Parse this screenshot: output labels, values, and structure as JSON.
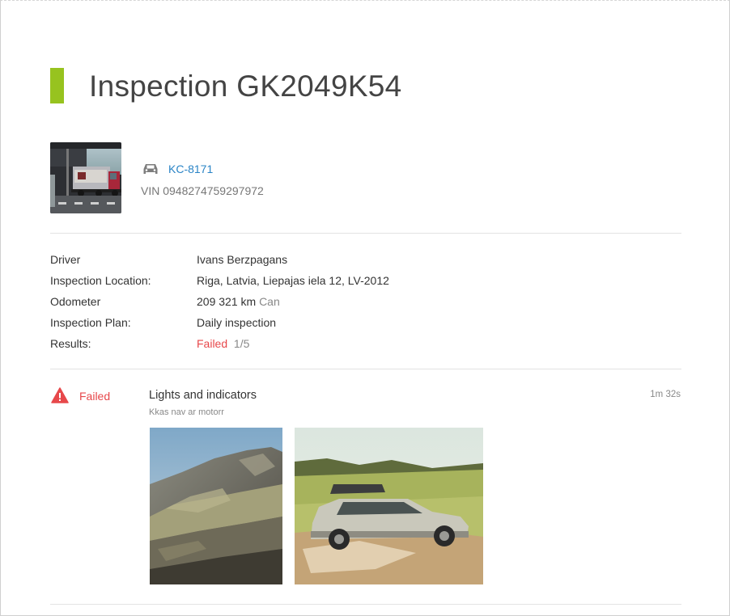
{
  "page": {
    "title": "Inspection GK2049K54",
    "accent_color": "#97c31f"
  },
  "vehicle": {
    "icon": "car-icon",
    "plate": "KC-8171",
    "vin": "VIN 0948274759297972"
  },
  "details": [
    {
      "label": "Driver",
      "value": "Ivans Berzpagans"
    },
    {
      "label": "Inspection Location:",
      "value": "Riga, Latvia, Liepajas iela 12, LV-2012"
    },
    {
      "label": "Odometer",
      "value": "209 321 km",
      "extra": "Can"
    },
    {
      "label": "Inspection Plan:",
      "value": "Daily inspection"
    },
    {
      "label": "Results:",
      "value": "Failed",
      "extra": "1/5"
    }
  ],
  "result_item": {
    "status_icon": "warning-triangle-icon",
    "status": "Failed",
    "status_color": "#e7484b",
    "title": "Lights and indicators",
    "note": "Kkas nav ar motorr",
    "duration": "1m 32s",
    "photos": [
      "mountain-photo",
      "car-offroad-photo"
    ]
  },
  "colors": {
    "link": "#2a84c6",
    "failed": "#e7484b"
  }
}
